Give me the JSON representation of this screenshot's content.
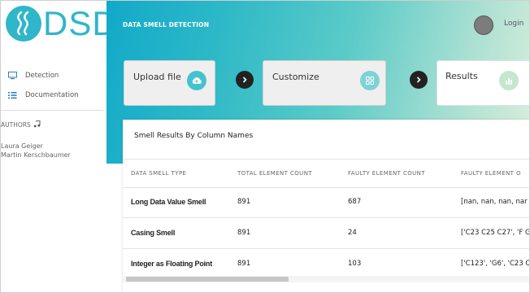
{
  "brand": {
    "logo_text": "DSD"
  },
  "sidebar": {
    "items": [
      {
        "label": "Detection",
        "icon": "monitor-icon"
      },
      {
        "label": "Documentation",
        "icon": "list-icon"
      }
    ],
    "authors_title": "AUTHORS",
    "authors": [
      "Laura Geiger",
      "Martin Kerschbaumer"
    ]
  },
  "header": {
    "title": "DATA SMELL DETECTION",
    "login_label": "Login"
  },
  "steps": [
    {
      "label": "Upload file",
      "icon": "cloud-upload-icon"
    },
    {
      "label": "Customize",
      "icon": "grid-icon"
    },
    {
      "label": "Results",
      "icon": "bar-chart-icon"
    }
  ],
  "results": {
    "title": "Smell Results By Column Names",
    "columns": [
      "DATA SMELL TYPE",
      "TOTAL ELEMENT COUNT",
      "FAULTY ELEMENT COUNT",
      "FAULTY ELEMENT O"
    ],
    "rows": [
      [
        "Long Data Value Smell",
        "891",
        "687",
        "[nan, nan, nan, nar"
      ],
      [
        "Casing Smell",
        "891",
        "24",
        "['C23 C25 C27', 'F G"
      ],
      [
        "Integer as Floating Point",
        "891",
        "103",
        "['C123', 'G6', 'C23 C"
      ]
    ]
  },
  "colors": {
    "accent": "#2fb6c9",
    "gradient_start": "#11a9c9",
    "gradient_end": "#dcefdc"
  }
}
